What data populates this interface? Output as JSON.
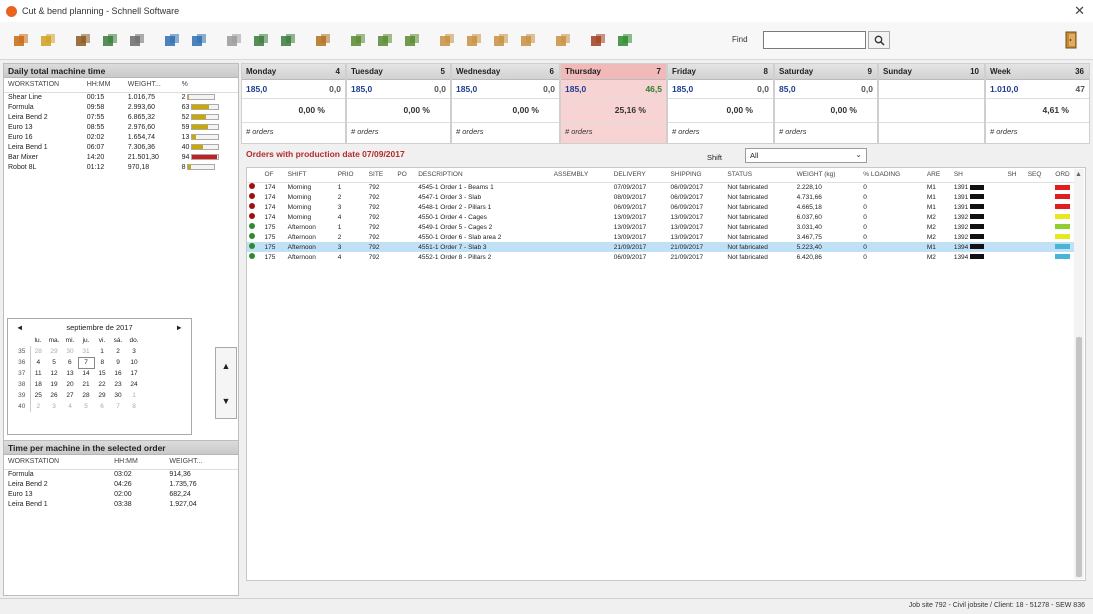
{
  "window": {
    "title": "Cut & bend planning - Schnell Software"
  },
  "toolbar": {
    "icons": [
      "pencil-icon",
      "grid-icon",
      "machines-icon",
      "cutting-icon",
      "bin-icon",
      "bend-left-icon",
      "bend-right-icon",
      "disabled-icon",
      "shape-icon",
      "wave-icon",
      "flag-icon",
      "layout-1-icon",
      "layout-2-icon",
      "layout-3-icon",
      "export-1-icon",
      "export-2-icon",
      "export-3-icon",
      "export-4-icon",
      "export-5-icon",
      "book-icon",
      "tree-icon"
    ],
    "find_label": "Find",
    "find_value": "",
    "exit_icon": "exit-door-icon"
  },
  "left": {
    "daily_title": "Daily total machine time",
    "daily_columns": [
      "WORKSTATION",
      "HH:MM",
      "WEIGHT...",
      "%"
    ],
    "daily_rows": [
      {
        "ws": "Shear Line",
        "time": "00:15",
        "weight": "1.016,75",
        "pct": "2",
        "fill": 0.02,
        "color": "#d9a800"
      },
      {
        "ws": "Formula",
        "time": "09:58",
        "weight": "2.993,60",
        "pct": "63",
        "fill": 0.63,
        "color": "#c9a800"
      },
      {
        "ws": "Leira Bend 2",
        "time": "07:55",
        "weight": "6.865,32",
        "pct": "52",
        "fill": 0.52,
        "color": "#c9a800"
      },
      {
        "ws": "Euro 13",
        "time": "08:55",
        "weight": "2.976,60",
        "pct": "59",
        "fill": 0.59,
        "color": "#c9a800"
      },
      {
        "ws": "Euro 16",
        "time": "02:02",
        "weight": "1.654,74",
        "pct": "13",
        "fill": 0.13,
        "color": "#c9a800"
      },
      {
        "ws": "Leira Bend 1",
        "time": "06:07",
        "weight": "7.306,36",
        "pct": "40",
        "fill": 0.4,
        "color": "#c9a800"
      },
      {
        "ws": "Bar Mixer",
        "time": "14:20",
        "weight": "21.501,30",
        "pct": "94",
        "fill": 0.94,
        "color": "#c42020"
      },
      {
        "ws": "Robot 8L",
        "time": "01:12",
        "weight": "970,18",
        "pct": "8",
        "fill": 0.08,
        "color": "#c9a800"
      }
    ],
    "calendar": {
      "month_label": "septiembre de 2017",
      "prev": "◄",
      "next": "►",
      "weekdays": [
        "lu.",
        "ma.",
        "mi.",
        "ju.",
        "vi.",
        "sá.",
        "do."
      ],
      "weeks": [
        {
          "wk": "35",
          "days": [
            "28",
            "29",
            "30",
            "31",
            "1",
            "2",
            "3"
          ]
        },
        {
          "wk": "36",
          "days": [
            "4",
            "5",
            "6",
            "7",
            "8",
            "9",
            "10"
          ]
        },
        {
          "wk": "37",
          "days": [
            "11",
            "12",
            "13",
            "14",
            "15",
            "16",
            "17"
          ]
        },
        {
          "wk": "38",
          "days": [
            "18",
            "19",
            "20",
            "21",
            "22",
            "23",
            "24"
          ]
        },
        {
          "wk": "39",
          "days": [
            "25",
            "26",
            "27",
            "28",
            "29",
            "30",
            "1"
          ]
        },
        {
          "wk": "40",
          "days": [
            "2",
            "3",
            "4",
            "5",
            "6",
            "7",
            "8"
          ]
        }
      ]
    },
    "up_arrow": "▲",
    "down_arrow": "▼",
    "order_title": "Time per machine in the selected order",
    "order_columns": [
      "WORKSTATION",
      "HH:MM",
      "WEIGHT..."
    ],
    "order_rows": [
      {
        "ws": "Formula",
        "time": "03:02",
        "weight": "914,36"
      },
      {
        "ws": "Leira Bend 2",
        "time": "04:26",
        "weight": "1.735,76"
      },
      {
        "ws": "Euro 13",
        "time": "02:00",
        "weight": "682,24"
      },
      {
        "ws": "Leira Bend 1",
        "time": "03:38",
        "weight": "1.927,04"
      }
    ]
  },
  "week": {
    "days": [
      {
        "name": "Monday",
        "num": "4",
        "left": "185,0",
        "right": "0,0",
        "pct": "0,00 %",
        "orders": "# orders"
      },
      {
        "name": "Tuesday",
        "num": "5",
        "left": "185,0",
        "right": "0,0",
        "pct": "0,00 %",
        "orders": "# orders"
      },
      {
        "name": "Wednesday",
        "num": "6",
        "left": "185,0",
        "right": "0,0",
        "pct": "0,00 %",
        "orders": "# orders"
      },
      {
        "name": "Thursday",
        "num": "7",
        "left": "185,0",
        "right": "46,5",
        "pct": "25,16 %",
        "orders": "# orders"
      },
      {
        "name": "Friday",
        "num": "8",
        "left": "185,0",
        "right": "0,0",
        "pct": "0,00 %",
        "orders": "# orders"
      },
      {
        "name": "Saturday",
        "num": "9",
        "left": "85,0",
        "right": "0,0",
        "pct": "0,00 %",
        "orders": "# orders"
      },
      {
        "name": "Sunday",
        "num": "10",
        "left": "",
        "right": "",
        "pct": "",
        "orders": ""
      },
      {
        "name": "Week",
        "num": "36",
        "left": "1.010,0",
        "right": "47",
        "pct": "4,61 %",
        "orders": "# orders"
      }
    ]
  },
  "orders": {
    "title": "Orders with production date 07/09/2017",
    "shift_label": "Shift",
    "shift_value": "All",
    "columns": [
      "OF",
      "SHIFT",
      "PRIO",
      "SITE",
      "PO",
      "DESCRIPTION",
      "ASSEMBLY",
      "DELIVERY",
      "SHIPPING",
      "STATUS",
      "WEIGHT (kg)",
      "% LOADING",
      "ARE",
      "SH",
      "SH",
      "SEQ",
      "ORD"
    ],
    "rows": [
      {
        "dot": "#a01010",
        "of": "174",
        "shift": "Morning",
        "sc": "m",
        "prio": "1",
        "site": "792",
        "desc": "4545-1 Order 1 - Beams 1",
        "delivery": "07/09/2017",
        "shipping": "06/09/2017",
        "status": "Not fabricated",
        "weight": "2.228,10",
        "load": "0",
        "are": "M1",
        "sh": "1391",
        "ord": "#e01e1e"
      },
      {
        "dot": "#a01010",
        "of": "174",
        "shift": "Morning",
        "sc": "m",
        "prio": "2",
        "site": "792",
        "desc": "4547-1 Order 3 - Slab",
        "delivery": "08/09/2017",
        "shipping": "06/09/2017",
        "status": "Not fabricated",
        "weight": "4.731,66",
        "load": "0",
        "are": "M1",
        "sh": "1391",
        "ord": "#e01e1e"
      },
      {
        "dot": "#a01010",
        "of": "174",
        "shift": "Morning",
        "sc": "m",
        "prio": "3",
        "site": "792",
        "desc": "4548-1 Order 2 - Pillars 1",
        "delivery": "06/09/2017",
        "shipping": "06/09/2017",
        "status": "Not fabricated",
        "weight": "4.665,18",
        "load": "0",
        "are": "M1",
        "sh": "1391",
        "ord": "#e01e1e"
      },
      {
        "dot": "#a01010",
        "of": "174",
        "shift": "Morning",
        "sc": "m",
        "prio": "4",
        "site": "792",
        "desc": "4550-1 Order 4 - Cages",
        "delivery": "13/09/2017",
        "shipping": "13/09/2017",
        "status": "Not fabricated",
        "weight": "6.037,60",
        "load": "0",
        "are": "M2",
        "sh": "1392",
        "ord": "#e8e820"
      },
      {
        "dot": "#2e8a2e",
        "of": "175",
        "shift": "Afternoon",
        "sc": "a",
        "prio": "1",
        "site": "792",
        "desc": "4549-1 Order 5 - Cages 2",
        "delivery": "13/09/2017",
        "shipping": "13/09/2017",
        "status": "Not fabricated",
        "weight": "3.031,40",
        "load": "0",
        "are": "M2",
        "sh": "1392",
        "ord": "#8fce2e"
      },
      {
        "dot": "#2e8a2e",
        "of": "175",
        "shift": "Afternoon",
        "sc": "a",
        "prio": "2",
        "site": "792",
        "desc": "4550-1 Order 6 - Slab area 2",
        "delivery": "13/09/2017",
        "shipping": "13/09/2017",
        "status": "Not fabricated",
        "weight": "3.467,75",
        "load": "0",
        "are": "M2",
        "sh": "1392",
        "ord": "#e8e820"
      },
      {
        "dot": "#2e8a2e",
        "of": "175",
        "shift": "Afternoon",
        "sc": "a",
        "prio": "3",
        "site": "792",
        "desc": "4551-1 Order 7 - Slab 3",
        "delivery": "21/09/2017",
        "shipping": "21/09/2017",
        "status": "Not fabricated",
        "weight": "5.223,40",
        "load": "0",
        "are": "M1",
        "sh": "1394",
        "ord": "#48b4d8",
        "selected": true
      },
      {
        "dot": "#2e8a2e",
        "of": "175",
        "shift": "Afternoon",
        "sc": "a",
        "prio": "4",
        "site": "792",
        "desc": "4552-1 Order 8 - Pillars 2",
        "delivery": "06/09/2017",
        "shipping": "21/09/2017",
        "status": "Not fabricated",
        "weight": "6.420,86",
        "load": "0",
        "are": "M2",
        "sh": "1394",
        "ord": "#48b4d8"
      }
    ]
  },
  "status": {
    "text": "Job site 792 - Civil jobsite / Client: 18 - 51278 - SEW 836"
  }
}
